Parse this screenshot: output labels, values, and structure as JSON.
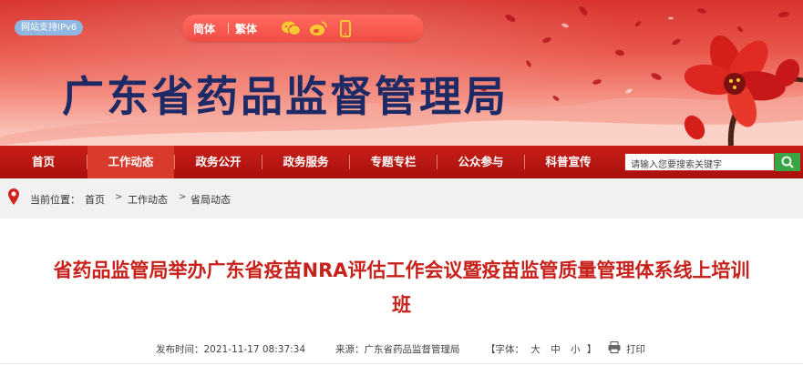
{
  "header": {
    "ipv6_badge": "网站支持IPv6",
    "lang_simplified": "简体",
    "lang_traditional": "繁体",
    "site_title": "广东省药品监督管理局"
  },
  "nav": {
    "items": [
      {
        "label": "首页",
        "active": false
      },
      {
        "label": "工作动态",
        "active": true
      },
      {
        "label": "政务公开",
        "active": false
      },
      {
        "label": "政务服务",
        "active": false
      },
      {
        "label": "专题专栏",
        "active": false
      },
      {
        "label": "公众参与",
        "active": false
      },
      {
        "label": "科普宣传",
        "active": false
      }
    ],
    "search_placeholder": "请输入您要搜索关键字"
  },
  "breadcrumb": {
    "prefix": "当前位置：",
    "items": [
      "首页",
      "工作动态",
      "省局动态"
    ],
    "separator": ">"
  },
  "article": {
    "title_line1": "省药品监管局举办广东省疫苗NRA评估工作会议暨疫苗监管质量管理体系线上培训",
    "title_line2": "班",
    "publish_label": "发布时间：",
    "publish_time": "2021-11-17 08:37:34",
    "source_label": "来源：",
    "source": "广东省药品监督管理局",
    "font_label": "【字体：",
    "font_large": "大",
    "font_medium": "中",
    "font_small": "小",
    "font_close": "】",
    "print_label": "打印"
  },
  "colors": {
    "nav_bg": "#b8150f",
    "nav_active": "#d83a2c",
    "title_color": "#c8201a",
    "site_title_color": "#1e2a66",
    "search_button": "#3aa545"
  }
}
